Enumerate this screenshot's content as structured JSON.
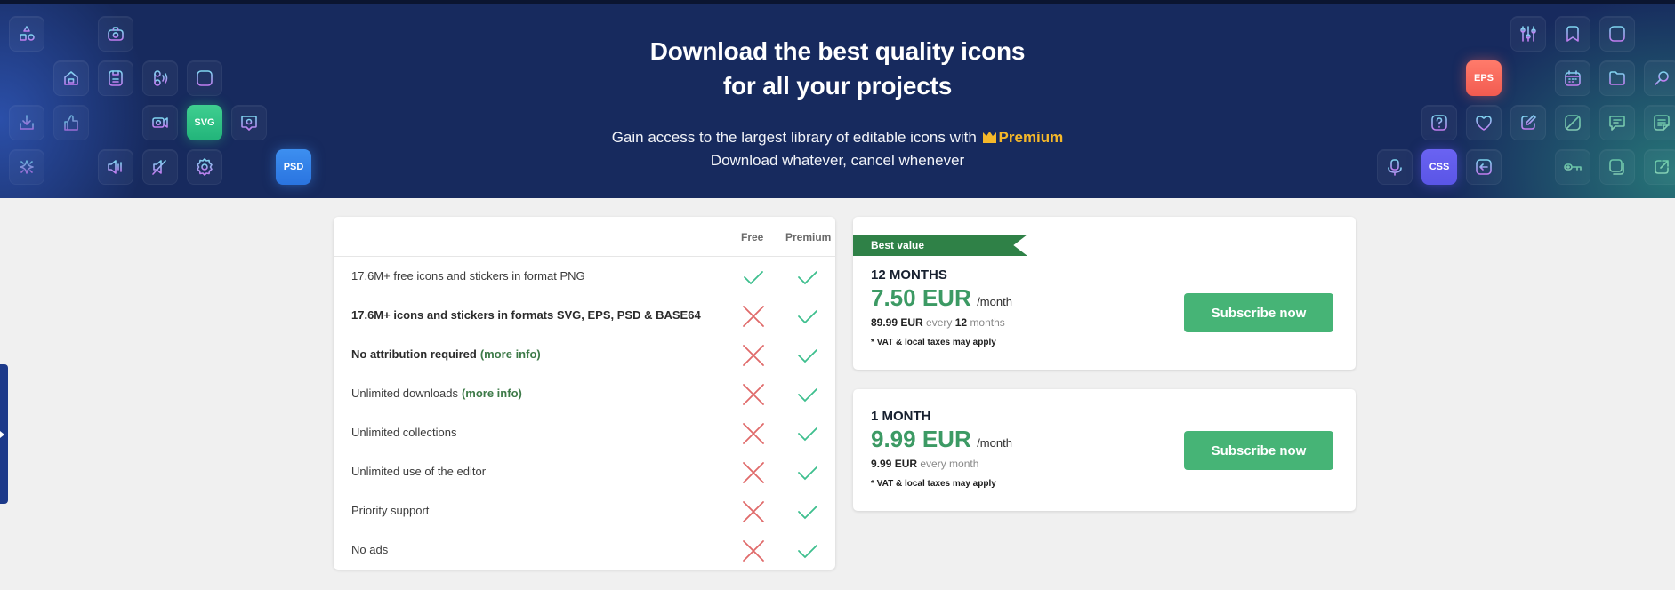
{
  "hero": {
    "title_line1": "Download the best quality icons",
    "title_line2": "for all your projects",
    "subtitle_prefix": "Gain access to the largest library of editable icons with",
    "premium_label": "Premium",
    "subtitle_line2": "Download whatever, cancel whenever",
    "premium_color": "#f5b82a"
  },
  "banner_tiles": {
    "left": [
      {
        "icon": "shapes-icon"
      },
      {
        "icon": "camera-icon"
      },
      {
        "icon": "home-icon"
      },
      {
        "icon": "save-icon"
      },
      {
        "icon": "voice-icon"
      },
      {
        "icon": "minus-square-icon"
      },
      {
        "icon": "download-icon"
      },
      {
        "icon": "thumbs-up-icon"
      },
      {
        "icon": "video-icon"
      },
      {
        "format": "SVG"
      },
      {
        "icon": "message-pin-icon"
      },
      {
        "icon": "sparkle-icon"
      },
      {
        "icon": "volume-icon"
      },
      {
        "icon": "mute-icon"
      },
      {
        "icon": "settings-icon"
      },
      {
        "format": "PSD"
      }
    ],
    "right": [
      {
        "icon": "sliders-icon"
      },
      {
        "icon": "bookmark-icon"
      },
      {
        "icon": "alert-icon"
      },
      {
        "format": "EPS"
      },
      {
        "icon": "calendar-icon"
      },
      {
        "icon": "folder-icon"
      },
      {
        "icon": "search-icon"
      },
      {
        "icon": "question-icon"
      },
      {
        "icon": "heart-icon"
      },
      {
        "icon": "edit-icon"
      },
      {
        "icon": "slash-square-icon"
      },
      {
        "icon": "chat-icon"
      },
      {
        "icon": "note-icon"
      },
      {
        "icon": "microphone-icon"
      },
      {
        "format": "CSS"
      },
      {
        "icon": "arrow-left-square-icon"
      },
      {
        "icon": "key-icon"
      },
      {
        "icon": "copy-icon"
      },
      {
        "icon": "external-link-icon"
      }
    ]
  },
  "formats": {
    "svg": "SVG",
    "psd": "PSD",
    "eps": "EPS",
    "css": "CSS"
  },
  "features": {
    "col_free": "Free",
    "col_premium": "Premium",
    "rows": [
      {
        "label": "17.6M+ free icons and stickers in format PNG",
        "more": "",
        "free": true,
        "premium": true
      },
      {
        "label": "17.6M+ icons and stickers in formats SVG, EPS, PSD & BASE64",
        "more": "",
        "free": false,
        "premium": true
      },
      {
        "label": "No attribution required",
        "more": "(more info)",
        "free": false,
        "premium": true
      },
      {
        "label": "Unlimited downloads",
        "more": "(more info)",
        "free": false,
        "premium": true
      },
      {
        "label": "Unlimited collections",
        "more": "",
        "free": false,
        "premium": true
      },
      {
        "label": "Unlimited use of the editor",
        "more": "",
        "free": false,
        "premium": true
      },
      {
        "label": "Priority support",
        "more": "",
        "free": false,
        "premium": true
      },
      {
        "label": "No ads",
        "more": "",
        "free": false,
        "premium": true
      }
    ]
  },
  "plans": [
    {
      "badge": "Best value",
      "period": "12 MONTHS",
      "price": "7.50 EUR",
      "per": "/month",
      "billing_amount": "89.99 EUR",
      "billing_every": "every",
      "billing_count": "12",
      "billing_unit": "months",
      "vat": "* VAT & local taxes may apply",
      "cta": "Subscribe now"
    },
    {
      "period": "1 MONTH",
      "price": "9.99 EUR",
      "per": "/month",
      "billing_amount": "9.99 EUR",
      "billing_text": "every month",
      "vat": "* VAT & local taxes may apply",
      "cta": "Subscribe now"
    }
  ],
  "colors": {
    "banner": "#172a5e",
    "check": "#3dbf8e",
    "cross": "#e06a6a",
    "price": "#3c9a64",
    "ribbon": "#2f8147",
    "button": "#46b476"
  }
}
